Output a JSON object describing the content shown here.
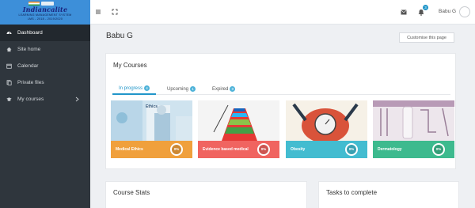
{
  "logo": {
    "title": "Indiancalite",
    "line1": "LEARNING MANAGEMENT SYSTEM",
    "line2": "LMS - 2018 - 2019/2020"
  },
  "sidebar": {
    "items": [
      {
        "label": "Dashboard",
        "icon": "dashboard-icon"
      },
      {
        "label": "Site home",
        "icon": "home-icon"
      },
      {
        "label": "Calendar",
        "icon": "calendar-icon"
      },
      {
        "label": "Private files",
        "icon": "file-icon"
      },
      {
        "label": "My courses",
        "icon": "graduation-cap-icon"
      }
    ]
  },
  "topbar": {
    "notification_count": "3",
    "user_name": "Babu G"
  },
  "header": {
    "title": "Babu G",
    "customise_label": "Customise this page"
  },
  "my_courses": {
    "title": "My Courses",
    "tabs": [
      {
        "label": "In progress",
        "count": "4"
      },
      {
        "label": "Upcoming",
        "count": "1"
      },
      {
        "label": "Expired",
        "count": "0"
      }
    ],
    "courses": [
      {
        "name": "Medical Ethics",
        "progress": "0%",
        "color": "#f0a03c"
      },
      {
        "name": "Evidence based medical",
        "progress": "0%",
        "color": "#f06460"
      },
      {
        "name": "Obesity",
        "progress": "0%",
        "color": "#43bcd0"
      },
      {
        "name": "Dermatology",
        "progress": "0%",
        "color": "#3dba8e"
      }
    ],
    "image_text": "Ethics"
  },
  "course_stats": {
    "title": "Course Stats"
  },
  "tasks": {
    "title": "Tasks to complete"
  },
  "colors": {
    "sidebar_bg": "#2f363d",
    "logo_bg": "#3d8fd9",
    "accent": "#2196c9"
  }
}
